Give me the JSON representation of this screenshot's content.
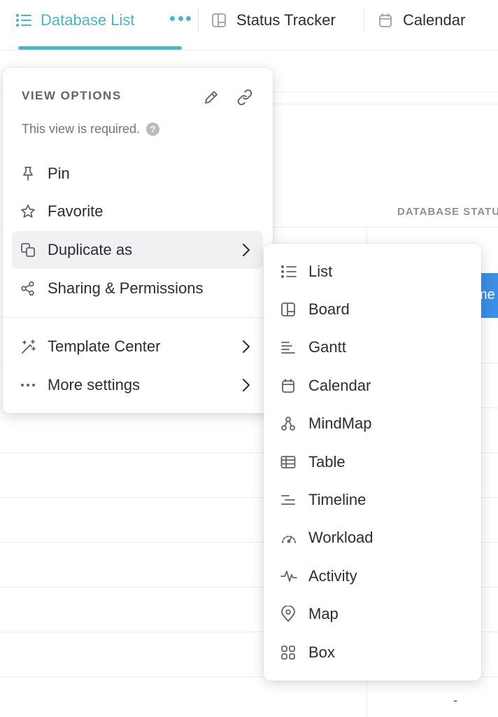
{
  "tabs": {
    "database_list": "Database List",
    "status_tracker": "Status Tracker",
    "calendar": "Calendar"
  },
  "background": {
    "column_header": "DATABASE STATUS",
    "blue_cell_text": "me",
    "dash_cell": "-"
  },
  "view_options": {
    "header": "VIEW OPTIONS",
    "note": "This view is required.",
    "items": [
      {
        "label": "Pin",
        "icon": "pin-icon"
      },
      {
        "label": "Favorite",
        "icon": "star-icon"
      },
      {
        "label": "Duplicate as",
        "icon": "duplicate-icon",
        "submenu": true,
        "active": true
      },
      {
        "label": "Sharing & Permissions",
        "icon": "share-icon"
      },
      {
        "label": "Template Center",
        "icon": "magic-wand-icon",
        "submenu": true
      },
      {
        "label": "More settings",
        "icon": "more-dots-icon",
        "submenu": true
      }
    ]
  },
  "duplicate_submenu": {
    "items": [
      {
        "label": "List",
        "icon": "list-icon"
      },
      {
        "label": "Board",
        "icon": "board-icon"
      },
      {
        "label": "Gantt",
        "icon": "gantt-icon"
      },
      {
        "label": "Calendar",
        "icon": "calendar-icon"
      },
      {
        "label": "MindMap",
        "icon": "mindmap-icon"
      },
      {
        "label": "Table",
        "icon": "table-icon"
      },
      {
        "label": "Timeline",
        "icon": "timeline-icon"
      },
      {
        "label": "Workload",
        "icon": "workload-icon"
      },
      {
        "label": "Activity",
        "icon": "activity-icon"
      },
      {
        "label": "Map",
        "icon": "map-pin-icon"
      },
      {
        "label": "Box",
        "icon": "box-icon"
      }
    ]
  },
  "colors": {
    "accent": "#49b6cc",
    "text": "#2a2e34",
    "muted": "#70757c",
    "active_bg": "#f0f1f3",
    "blue_cell": "#3c8ee6"
  }
}
